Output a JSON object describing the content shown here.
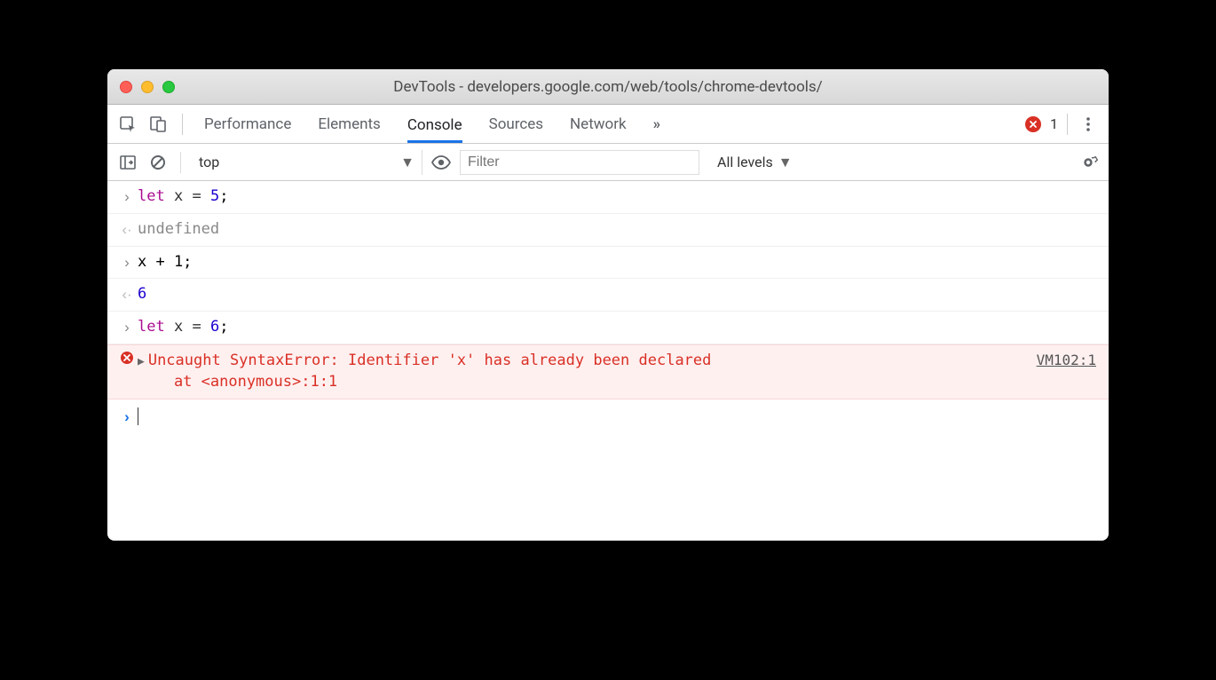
{
  "window": {
    "title": "DevTools - developers.google.com/web/tools/chrome-devtools/"
  },
  "toolbar": {
    "tabs": [
      {
        "label": "Performance"
      },
      {
        "label": "Elements"
      },
      {
        "label": "Console"
      },
      {
        "label": "Sources"
      },
      {
        "label": "Network"
      }
    ],
    "active_tab_index": 2,
    "overflow_glyph": "»",
    "error_count": "1"
  },
  "subbar": {
    "context": "top",
    "filter_placeholder": "Filter",
    "levels_label": "All levels"
  },
  "console": {
    "entries": [
      {
        "type": "input",
        "code": {
          "pre": "let",
          "mid": " x ",
          "op": "=",
          "after": " ",
          "num": "5",
          "tail": ";"
        }
      },
      {
        "type": "output",
        "text": "undefined"
      },
      {
        "type": "input",
        "plain": "x + 1;"
      },
      {
        "type": "output",
        "num": "6"
      },
      {
        "type": "input",
        "code": {
          "pre": "let",
          "mid": " x ",
          "op": "=",
          "after": " ",
          "num": "6",
          "tail": ";"
        }
      },
      {
        "type": "error",
        "message": "Uncaught SyntaxError: Identifier 'x' has already been declared",
        "stack": "    at <anonymous>:1:1",
        "source": "VM102:1"
      }
    ]
  }
}
